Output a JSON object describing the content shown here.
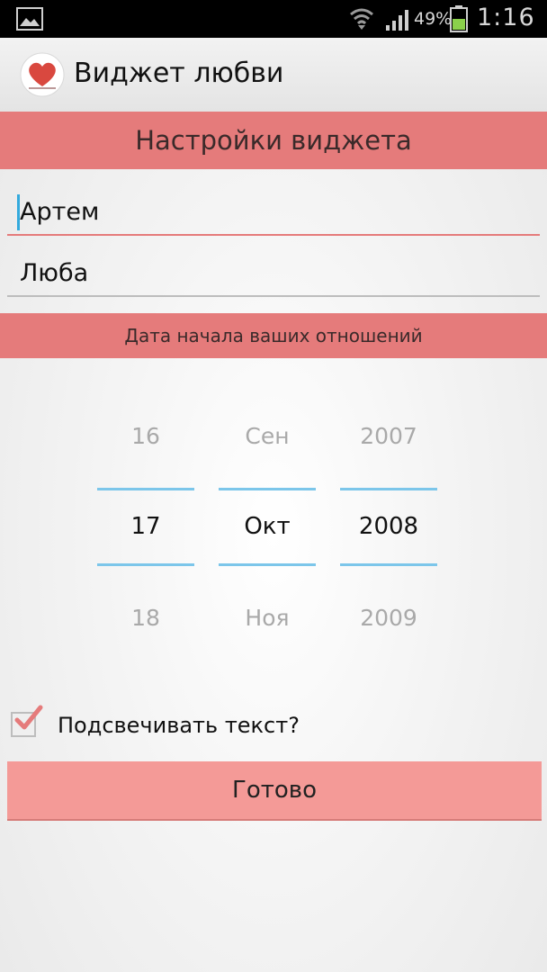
{
  "status_bar": {
    "battery_percent": "49%",
    "time": "1:16",
    "icons": [
      "gallery-icon",
      "wifi-icon",
      "signal-icon",
      "battery-icon"
    ]
  },
  "action_bar": {
    "title": "Виджет любви",
    "logo_icon": "heart-icon"
  },
  "settings_header": "Настройки виджета",
  "fields": {
    "name1": "Артем",
    "name2": "Люба"
  },
  "date_header": "Дата начала ваших отношений",
  "date_picker": {
    "day": {
      "prev": "16",
      "selected": "17",
      "next": "18"
    },
    "month": {
      "prev": "Сен",
      "selected": "Окт",
      "next": "Ноя"
    },
    "year": {
      "prev": "2007",
      "selected": "2008",
      "next": "2009"
    }
  },
  "highlight": {
    "label": "Подсвечивать текст?",
    "checked": true
  },
  "done_label": "Готово",
  "colors": {
    "accent": "#e57b7b",
    "button": "#f49a97",
    "picker_line": "#7cc6ea",
    "cursor": "#33aadd"
  }
}
